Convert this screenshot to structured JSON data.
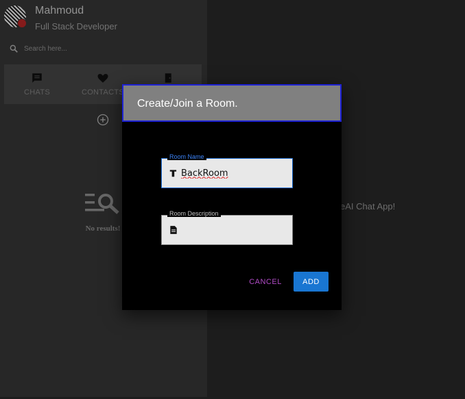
{
  "user": {
    "name": "Mahmoud",
    "role": "Full Stack Developer"
  },
  "search": {
    "placeholder": "Search here..."
  },
  "tabs": [
    {
      "label": "CHATS",
      "icon": "chat-icon"
    },
    {
      "label": "CONTACTS",
      "icon": "heart-icon"
    },
    {
      "label": "",
      "icon": "exit-door-icon"
    }
  ],
  "empty_state": {
    "text": "No results!",
    "icon": "search-list-icon"
  },
  "main": {
    "welcome_text": "eAI Chat App!"
  },
  "dialog": {
    "title": "Create/Join a Room.",
    "room_name": {
      "label": "Room Name",
      "value": "BackRoom",
      "icon": "text-format-icon"
    },
    "room_description": {
      "label": "Room Description",
      "value": "",
      "icon": "description-icon"
    },
    "cancel_label": "CANCEL",
    "add_label": "ADD"
  },
  "colors": {
    "accent_blue": "#1976d2",
    "cancel_purple": "#b04bc6",
    "status_badge": "#c62828",
    "header_border": "#1e22d6"
  }
}
